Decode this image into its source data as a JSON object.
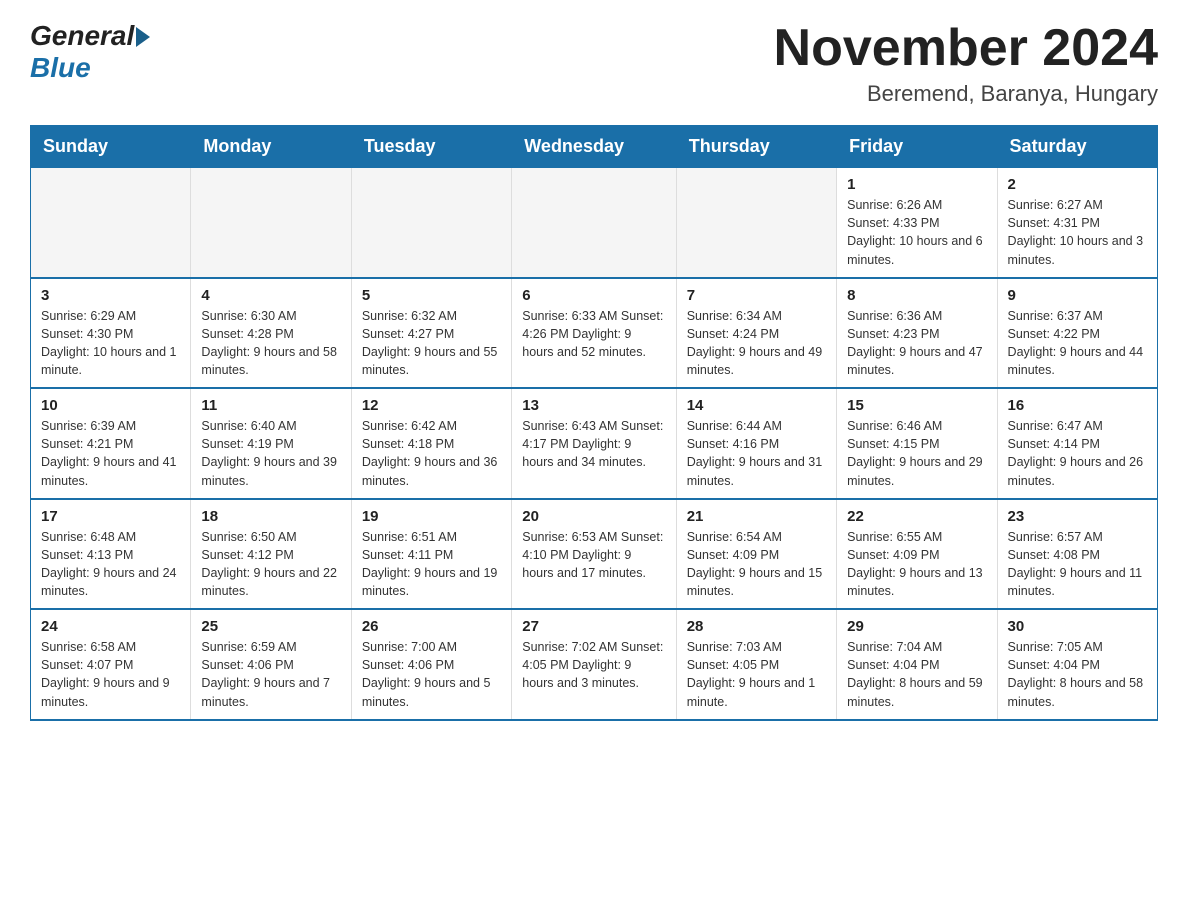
{
  "header": {
    "logo_general": "General",
    "logo_blue": "Blue",
    "title": "November 2024",
    "subtitle": "Beremend, Baranya, Hungary"
  },
  "days_of_week": [
    "Sunday",
    "Monday",
    "Tuesday",
    "Wednesday",
    "Thursday",
    "Friday",
    "Saturday"
  ],
  "weeks": [
    [
      {
        "day": "",
        "info": ""
      },
      {
        "day": "",
        "info": ""
      },
      {
        "day": "",
        "info": ""
      },
      {
        "day": "",
        "info": ""
      },
      {
        "day": "",
        "info": ""
      },
      {
        "day": "1",
        "info": "Sunrise: 6:26 AM\nSunset: 4:33 PM\nDaylight: 10 hours and 6 minutes."
      },
      {
        "day": "2",
        "info": "Sunrise: 6:27 AM\nSunset: 4:31 PM\nDaylight: 10 hours and 3 minutes."
      }
    ],
    [
      {
        "day": "3",
        "info": "Sunrise: 6:29 AM\nSunset: 4:30 PM\nDaylight: 10 hours and 1 minute."
      },
      {
        "day": "4",
        "info": "Sunrise: 6:30 AM\nSunset: 4:28 PM\nDaylight: 9 hours and 58 minutes."
      },
      {
        "day": "5",
        "info": "Sunrise: 6:32 AM\nSunset: 4:27 PM\nDaylight: 9 hours and 55 minutes."
      },
      {
        "day": "6",
        "info": "Sunrise: 6:33 AM\nSunset: 4:26 PM\nDaylight: 9 hours and 52 minutes."
      },
      {
        "day": "7",
        "info": "Sunrise: 6:34 AM\nSunset: 4:24 PM\nDaylight: 9 hours and 49 minutes."
      },
      {
        "day": "8",
        "info": "Sunrise: 6:36 AM\nSunset: 4:23 PM\nDaylight: 9 hours and 47 minutes."
      },
      {
        "day": "9",
        "info": "Sunrise: 6:37 AM\nSunset: 4:22 PM\nDaylight: 9 hours and 44 minutes."
      }
    ],
    [
      {
        "day": "10",
        "info": "Sunrise: 6:39 AM\nSunset: 4:21 PM\nDaylight: 9 hours and 41 minutes."
      },
      {
        "day": "11",
        "info": "Sunrise: 6:40 AM\nSunset: 4:19 PM\nDaylight: 9 hours and 39 minutes."
      },
      {
        "day": "12",
        "info": "Sunrise: 6:42 AM\nSunset: 4:18 PM\nDaylight: 9 hours and 36 minutes."
      },
      {
        "day": "13",
        "info": "Sunrise: 6:43 AM\nSunset: 4:17 PM\nDaylight: 9 hours and 34 minutes."
      },
      {
        "day": "14",
        "info": "Sunrise: 6:44 AM\nSunset: 4:16 PM\nDaylight: 9 hours and 31 minutes."
      },
      {
        "day": "15",
        "info": "Sunrise: 6:46 AM\nSunset: 4:15 PM\nDaylight: 9 hours and 29 minutes."
      },
      {
        "day": "16",
        "info": "Sunrise: 6:47 AM\nSunset: 4:14 PM\nDaylight: 9 hours and 26 minutes."
      }
    ],
    [
      {
        "day": "17",
        "info": "Sunrise: 6:48 AM\nSunset: 4:13 PM\nDaylight: 9 hours and 24 minutes."
      },
      {
        "day": "18",
        "info": "Sunrise: 6:50 AM\nSunset: 4:12 PM\nDaylight: 9 hours and 22 minutes."
      },
      {
        "day": "19",
        "info": "Sunrise: 6:51 AM\nSunset: 4:11 PM\nDaylight: 9 hours and 19 minutes."
      },
      {
        "day": "20",
        "info": "Sunrise: 6:53 AM\nSunset: 4:10 PM\nDaylight: 9 hours and 17 minutes."
      },
      {
        "day": "21",
        "info": "Sunrise: 6:54 AM\nSunset: 4:09 PM\nDaylight: 9 hours and 15 minutes."
      },
      {
        "day": "22",
        "info": "Sunrise: 6:55 AM\nSunset: 4:09 PM\nDaylight: 9 hours and 13 minutes."
      },
      {
        "day": "23",
        "info": "Sunrise: 6:57 AM\nSunset: 4:08 PM\nDaylight: 9 hours and 11 minutes."
      }
    ],
    [
      {
        "day": "24",
        "info": "Sunrise: 6:58 AM\nSunset: 4:07 PM\nDaylight: 9 hours and 9 minutes."
      },
      {
        "day": "25",
        "info": "Sunrise: 6:59 AM\nSunset: 4:06 PM\nDaylight: 9 hours and 7 minutes."
      },
      {
        "day": "26",
        "info": "Sunrise: 7:00 AM\nSunset: 4:06 PM\nDaylight: 9 hours and 5 minutes."
      },
      {
        "day": "27",
        "info": "Sunrise: 7:02 AM\nSunset: 4:05 PM\nDaylight: 9 hours and 3 minutes."
      },
      {
        "day": "28",
        "info": "Sunrise: 7:03 AM\nSunset: 4:05 PM\nDaylight: 9 hours and 1 minute."
      },
      {
        "day": "29",
        "info": "Sunrise: 7:04 AM\nSunset: 4:04 PM\nDaylight: 8 hours and 59 minutes."
      },
      {
        "day": "30",
        "info": "Sunrise: 7:05 AM\nSunset: 4:04 PM\nDaylight: 8 hours and 58 minutes."
      }
    ]
  ]
}
